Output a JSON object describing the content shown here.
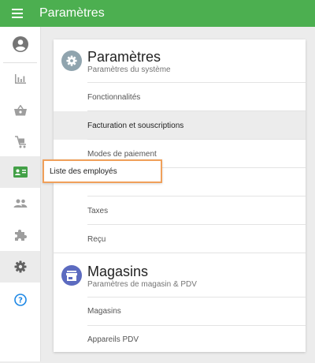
{
  "header": {
    "title": "Paramètres",
    "color": "#4caf50"
  },
  "sidebar": {
    "items": [
      {
        "icon": "account-icon"
      },
      {
        "icon": "bar-chart-icon"
      },
      {
        "icon": "basket-icon"
      },
      {
        "icon": "cart-icon"
      },
      {
        "icon": "employee-card-icon",
        "selected": true
      },
      {
        "icon": "people-icon"
      },
      {
        "icon": "puzzle-icon"
      },
      {
        "icon": "gear-icon",
        "active": true
      },
      {
        "icon": "help-icon",
        "color": "#1e88e5"
      }
    ],
    "tooltip": "Liste des employés"
  },
  "settings": {
    "title": "Paramètres",
    "subtitle": "Paramètres du système",
    "icon_color": "#90a4ae",
    "items": [
      {
        "label": "Fonctionnalités"
      },
      {
        "label": "Facturation et souscriptions",
        "highlighted": true
      },
      {
        "label": "Modes de paiement"
      },
      {
        "label": "Taxes"
      },
      {
        "label": "Reçu"
      }
    ]
  },
  "stores": {
    "title": "Magasins",
    "subtitle": "Paramètres de magasin & PDV",
    "icon_color": "#5c6bc0",
    "items": [
      {
        "label": "Magasins"
      },
      {
        "label": "Appareils PDV"
      }
    ]
  },
  "accent_tooltip_border": "#f0a05a"
}
